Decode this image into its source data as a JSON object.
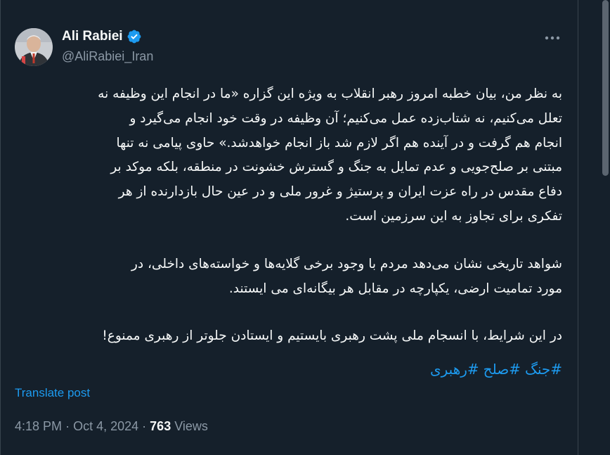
{
  "author": {
    "display_name": "Ali Rabiei",
    "handle": "@AliRabiei_Iran",
    "verified": true,
    "verified_color": "#1d9bf0"
  },
  "more_icon": "more-horizontal-icon",
  "post": {
    "paragraph1": [
      "به نظر من، بیان خطبه امروز رهبر انقلاب به ویژه این گزاره «ما در انجام این وظیفه نه",
      "تعلل می‌کنیم، نه شتاب‌زده عمل می‌کنیم؛ آن وظیفه در وقت خود انجام می‌گیرد و",
      "انجام هم گرفت و در آینده هم اگر لازم شد باز انجام خواهدشد.» حاوی پیامی نه تنها",
      "مبتنی بر صلح‌جویی و عدم تمایل به جنگ و گسترش خشونت در منطقه، بلکه موکد بر",
      "دفاع مقدس در راه عزت ایران و پرستیژ و غرور ملی و در عین حال بازدارنده از هر",
      "تفکری برای تجاوز به این سرزمین است."
    ],
    "paragraph2": [
      "شواهد تاریخی نشان می‌دهد مردم با وجود برخی گلایه‌ها و خواسته‌های داخلی، در",
      "مورد تمامیت ارضی، یکپارچه در مقابل هر بیگانه‌ای می ایستند."
    ],
    "paragraph3": [
      "در این شرایط، با انسجام ملی پشت رهبری بایستیم و ایستادن جلوتر از رهبری ممنوع!"
    ],
    "hashtags": [
      "#جنگ",
      "#صلح",
      "#رهبری"
    ]
  },
  "translate_label": "Translate post",
  "meta": {
    "time": "4:18 PM",
    "separator": "·",
    "date": "Oct 4, 2024",
    "views_count": "763",
    "views_label": "Views"
  },
  "colors": {
    "background": "#15202b",
    "text": "#f7f9f9",
    "secondary": "#8b98a5",
    "accent": "#1d9bf0"
  }
}
